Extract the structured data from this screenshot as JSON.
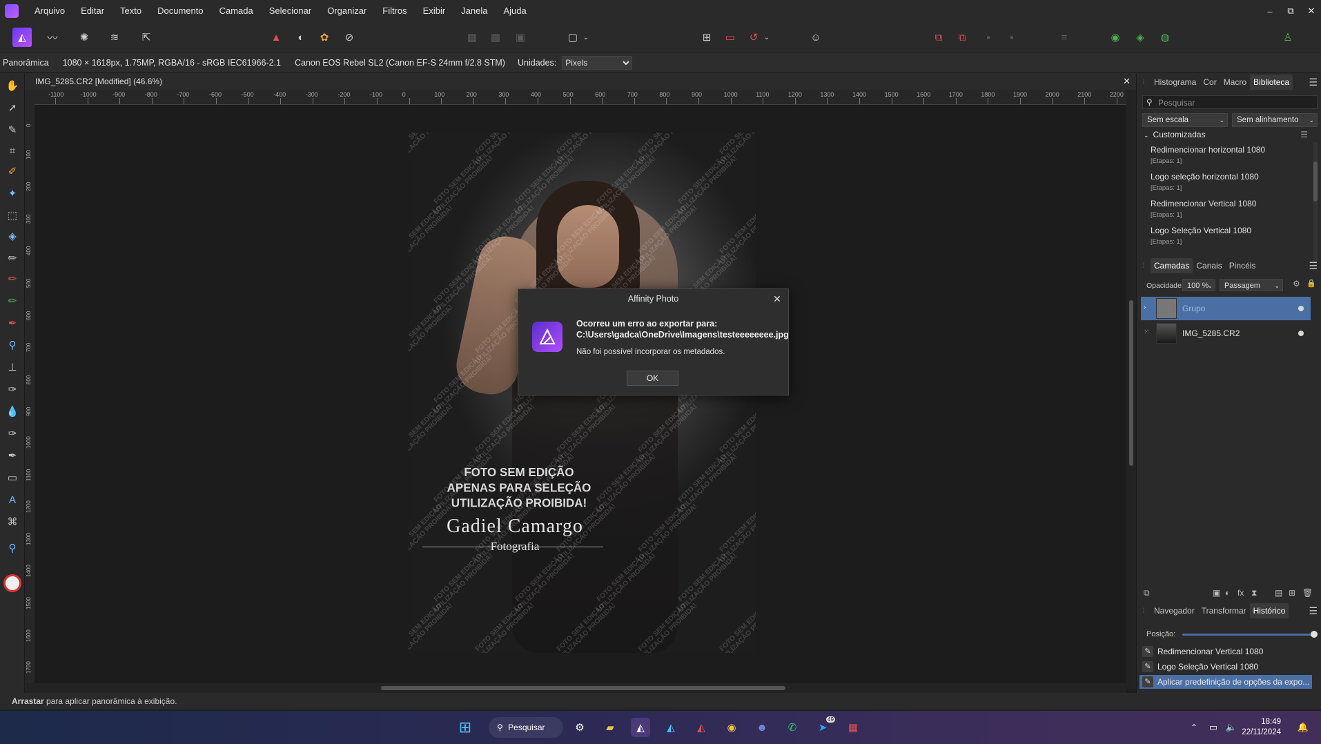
{
  "menubar": {
    "items": [
      "Arquivo",
      "Editar",
      "Texto",
      "Documento",
      "Camada",
      "Selecionar",
      "Organizar",
      "Filtros",
      "Exibir",
      "Janela",
      "Ajuda"
    ],
    "window_controls": [
      "–",
      "⧉",
      "✕"
    ]
  },
  "context_bar": {
    "tool": "Panorâmica",
    "image_info": "1080 × 1618px, 1.75MP, RGBA/16 - sRGB IEC61966-2.1",
    "camera": "Canon EOS Rebel SL2 (Canon EF-S 24mm f/2.8 STM)",
    "units_label": "Unidades:",
    "units_value": "Pixels"
  },
  "document": {
    "tab_title": "IMG_5285.CR2 [Modified] (46.6%)",
    "ruler_unit": "px",
    "h_ticks": [
      "-1100",
      "-1000",
      "-900",
      "-800",
      "-700",
      "-600",
      "-500",
      "-400",
      "-300",
      "-200",
      "-100",
      "0",
      "100",
      "200",
      "300",
      "400",
      "500",
      "600",
      "700",
      "800",
      "900",
      "1000",
      "1100",
      "1200",
      "1300",
      "1400",
      "1500",
      "1600",
      "1700",
      "1800",
      "1900",
      "2000",
      "2100",
      "2200"
    ],
    "v_ticks": [
      "0",
      "100",
      "200",
      "300",
      "400",
      "500",
      "600",
      "700",
      "800",
      "900",
      "1000",
      "1100",
      "1200",
      "1300",
      "1400",
      "1500",
      "1600",
      "1700"
    ]
  },
  "photo": {
    "watermark_small_1": "FOTO SEM EDIÇÃO",
    "watermark_small_2": "UTILIZAÇÃO PROIBIDA!",
    "watermark_main_1": "FOTO SEM EDIÇÃO",
    "watermark_main_2": "APENAS PARA SELEÇÃO",
    "watermark_main_3": "UTILIZAÇÃO PROIBIDA!",
    "signature": "Gadiel Camargo",
    "signature_sub": "Fotografia"
  },
  "dialog": {
    "title": "Affinity Photo",
    "line1": "Ocorreu um erro ao exportar para:",
    "line2": "C:\\Users\\gadca\\OneDrive\\Imagens\\testeeeeeeee.jpg",
    "line3": "Não foi possível incorporar os metadados.",
    "ok_label": "OK"
  },
  "library_panel": {
    "tabs": [
      "Histograma",
      "Cor",
      "Macro",
      "Biblioteca"
    ],
    "active_tab": "Biblioteca",
    "search_placeholder": "Pesquisar",
    "scale_option": "Sem escala",
    "align_option": "Sem alinhamento",
    "category": "Customizadas",
    "macros": [
      {
        "name": "Redimencionar horizontal 1080",
        "steps": "[Etapas: 1]"
      },
      {
        "name": "Logo seleção horizontal 1080",
        "steps": "[Etapas: 1]"
      },
      {
        "name": "Redimencionar Vertical 1080",
        "steps": "[Etapas: 1]"
      },
      {
        "name": "Logo Seleção Vertical 1080",
        "steps": "[Etapas: 1]"
      }
    ]
  },
  "layers_panel": {
    "tabs": [
      "Camadas",
      "Canais",
      "Pincéis"
    ],
    "active_tab": "Camadas",
    "opacity_label": "Opacidade:",
    "opacity_value": "100 %",
    "blend_mode": "Passagem",
    "layers": [
      {
        "name": "Grupo",
        "selected": true
      },
      {
        "name": "IMG_5285.CR2",
        "selected": false
      }
    ]
  },
  "history_panel": {
    "tabs": [
      "Navegador",
      "Transformar",
      "Histórico"
    ],
    "active_tab": "Histórico",
    "position_label": "Posição:",
    "position_fraction": 1.0,
    "items": [
      "Redimencionar Vertical 1080",
      "Logo Seleção Vertical 1080",
      "Aplicar predefinição de opções da expo..."
    ]
  },
  "status_bar": {
    "bold": "Arrastar",
    "rest": " para aplicar panorâmica à exibição."
  },
  "taskbar": {
    "search_label": "Pesquisar",
    "time": "18:49",
    "date": "22/11/2024",
    "telegram_badge": "49"
  },
  "colors": {
    "accent": "#4a6fa5",
    "selected_layer": "#4a6fa5",
    "brand": "#8b4dff"
  }
}
